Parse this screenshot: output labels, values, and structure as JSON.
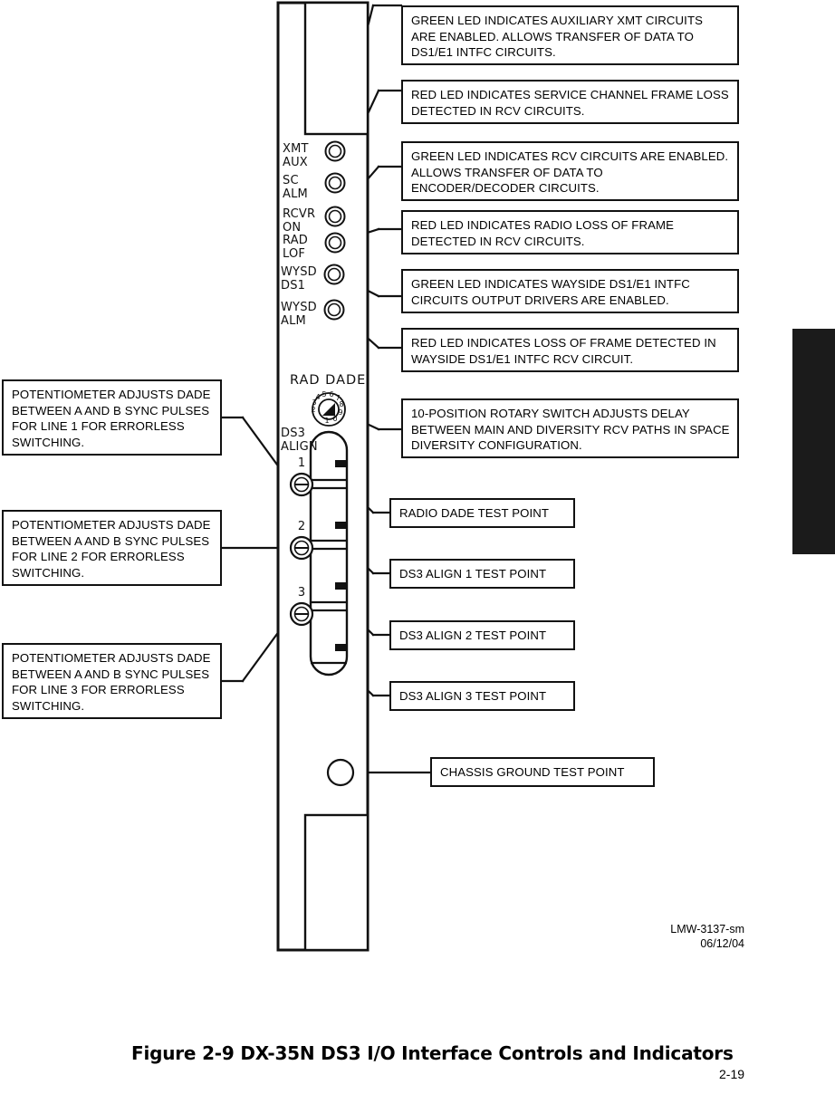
{
  "document": {
    "figure_caption": "Figure 2-9  DX-35N DS3 I/O Interface Controls and Indicators",
    "page_number": "2-19",
    "drawing_id": "LMW-3137-sm",
    "drawing_date": "06/12/04",
    "docid_block": "LMW-3137-sm\n06/12/04"
  },
  "panel": {
    "name": "DS3 I/O Interface front panel",
    "leds": [
      {
        "label": "XMT\nAUX",
        "name": "xmt-aux"
      },
      {
        "label": "SC\nALM",
        "name": "sc-alm"
      },
      {
        "label": "RCVR\nON",
        "name": "rcvr-on"
      },
      {
        "label": "RAD\nLOF",
        "name": "rad-lof"
      },
      {
        "label": "WYSD\nDS1",
        "name": "wysd-ds1"
      },
      {
        "label": "WYSD\nALM",
        "name": "wysd-alm"
      }
    ],
    "rotary_switch": {
      "label": "RAD DADE",
      "positions": [
        "0",
        "1",
        "2",
        "3",
        "4",
        "5",
        "6",
        "7",
        "8",
        "9"
      ],
      "dial_order": [
        "2",
        "3",
        "4",
        "5",
        "6",
        "7",
        "8",
        "9",
        "0",
        "1"
      ]
    },
    "ds3_align": {
      "label": "DS3\nALIGN",
      "potentiometers": [
        "1",
        "2",
        "3"
      ]
    },
    "test_points": [
      "radio-dade",
      "ds3-align-1",
      "ds3-align-2",
      "ds3-align-3"
    ],
    "chassis_ground": "chassis-ground-test-point"
  },
  "callouts": {
    "right": [
      {
        "name": "callout-xmt-aux",
        "text": "GREEN LED INDICATES AUXILIARY XMT CIRCUITS ARE ENABLED. ALLOWS TRANSFER OF DATA TO DS1/E1 INTFC CIRCUITS."
      },
      {
        "name": "callout-sc-alm",
        "text": "RED LED INDICATES SERVICE CHANNEL FRAME LOSS DETECTED IN RCV CIRCUITS."
      },
      {
        "name": "callout-rcvr-on",
        "text": "GREEN LED INDICATES RCV CIRCUITS ARE ENABLED. ALLOWS TRANSFER OF DATA TO ENCODER/DECODER CIRCUITS."
      },
      {
        "name": "callout-rad-lof",
        "text": "RED LED INDICATES RADIO LOSS OF FRAME DETECTED IN RCV CIRCUITS."
      },
      {
        "name": "callout-wysd-ds1",
        "text": "GREEN LED INDICATES WAYSIDE DS1/E1 INTFC CIRCUITS OUTPUT DRIVERS ARE ENABLED."
      },
      {
        "name": "callout-wysd-alm",
        "text": "RED LED INDICATES LOSS OF FRAME DETECTED IN WAYSIDE DS1/E1 INTFC RCV CIRCUIT."
      },
      {
        "name": "callout-rotary-switch",
        "text": "10-POSITION ROTARY SWITCH ADJUSTS DELAY BETWEEN MAIN AND DIVERSITY RCV PATHS IN SPACE DIVERSITY CONFIGURATION."
      },
      {
        "name": "callout-radio-dade-test-point",
        "text": "RADIO DADE TEST POINT"
      },
      {
        "name": "callout-ds3-align-1-test-point",
        "text": "DS3 ALIGN 1 TEST POINT"
      },
      {
        "name": "callout-ds3-align-2-test-point",
        "text": "DS3 ALIGN 2 TEST POINT"
      },
      {
        "name": "callout-ds3-align-3-test-point",
        "text": "DS3 ALIGN 3 TEST POINT"
      },
      {
        "name": "callout-chassis-ground-test-point",
        "text": "CHASSIS GROUND TEST POINT"
      }
    ],
    "left": [
      {
        "name": "callout-potentiometer-line-1",
        "text": "POTENTIOMETER ADJUSTS DADE BETWEEN A AND B SYNC PULSES FOR LINE 1 FOR ERRORLESS SWITCHING."
      },
      {
        "name": "callout-potentiometer-line-2",
        "text": "POTENTIOMETER ADJUSTS DADE BETWEEN A AND B SYNC PULSES FOR LINE 2 FOR ERRORLESS SWITCHING."
      },
      {
        "name": "callout-potentiometer-line-3",
        "text": "POTENTIOMETER ADJUSTS DADE BETWEEN A AND B SYNC PULSES FOR LINE 3 FOR ERRORLESS SWITCHING."
      }
    ]
  },
  "colors": {
    "ink": "#111111",
    "paper": "#ffffff",
    "tab": "#1b1b1b"
  }
}
